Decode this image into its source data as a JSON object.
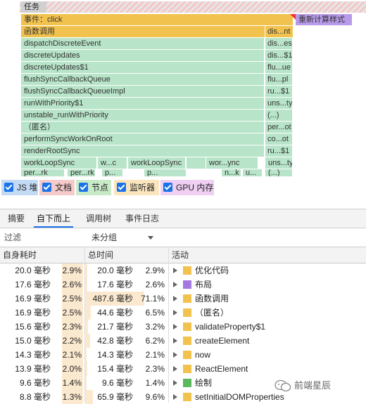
{
  "flame": {
    "task_label": "任务",
    "event_label": "事件：click",
    "recalc_label": "重新计算样式",
    "rows": [
      {
        "name": "函数调用",
        "side": "dis...nt",
        "color": "yellow"
      },
      {
        "name": "dispatchDiscreteEvent",
        "side": "dis...es",
        "color": "green"
      },
      {
        "name": "discreteUpdates",
        "side": "dis...$1",
        "color": "green"
      },
      {
        "name": "discreteUpdates$1",
        "side": "flu...ue",
        "color": "green"
      },
      {
        "name": "flushSyncCallbackQueue",
        "side": "flu...pl",
        "color": "green"
      },
      {
        "name": "flushSyncCallbackQueueImpl",
        "side": "ru...$1",
        "color": "green"
      },
      {
        "name": "runWithPriority$1",
        "side": "uns...ty",
        "color": "green"
      },
      {
        "name": "unstable_runWithPriority",
        "side": "(...)",
        "color": "green"
      },
      {
        "name": "（匿名）",
        "side": "per...ot",
        "color": "green"
      },
      {
        "name": "performSyncWorkOnRoot",
        "side": "co...ot",
        "color": "green"
      },
      {
        "name": "renderRootSync",
        "side": "ru...$1",
        "color": "green"
      }
    ],
    "work_row": [
      "workLoopSync",
      "w...c",
      "workLoopSync",
      "wor...ync",
      "uns...ty"
    ],
    "last_row": [
      "per...rk",
      "per...rk",
      "p...",
      "p...",
      "n...k",
      "u...",
      "(...)"
    ]
  },
  "filters": [
    {
      "label": "JS 堆",
      "color": "#4a90e2"
    },
    {
      "label": "文档",
      "color": "#e06060"
    },
    {
      "label": "节点",
      "color": "#5bc15b"
    },
    {
      "label": "监听器",
      "color": "#f0b23a"
    },
    {
      "label": "GPU 内存",
      "color": "#d070d8"
    }
  ],
  "tabs": [
    "摘要",
    "自下而上",
    "调用树",
    "事件日志"
  ],
  "active_tab": "自下而上",
  "filter_placeholder": "过滤",
  "group_value": "未分组",
  "columns": {
    "self": "自身耗时",
    "total": "总时间",
    "activity": "活动"
  },
  "rows": [
    {
      "self": "20.0 毫秒",
      "self_pct": "2.9%",
      "total": "20.0 毫秒",
      "total_pct": "2.9%",
      "name": "优化代码",
      "color": "#f2c24f",
      "total_share": 0.029
    },
    {
      "self": "17.6 毫秒",
      "self_pct": "2.6%",
      "total": "17.6 毫秒",
      "total_pct": "2.6%",
      "name": "布局",
      "color": "#a57ae0",
      "total_share": 0.026
    },
    {
      "self": "16.9 毫秒",
      "self_pct": "2.5%",
      "total": "487.6 毫秒",
      "total_pct": "71.1%",
      "name": "函数调用",
      "color": "#f2c24f",
      "total_share": 0.711
    },
    {
      "self": "16.9 毫秒",
      "self_pct": "2.5%",
      "total": "44.6 毫秒",
      "total_pct": "6.5%",
      "name": "（匿名）",
      "color": "#f2c24f",
      "total_share": 0.065
    },
    {
      "self": "15.6 毫秒",
      "self_pct": "2.3%",
      "total": "21.7 毫秒",
      "total_pct": "3.2%",
      "name": "validateProperty$1",
      "color": "#f2c24f",
      "total_share": 0.032
    },
    {
      "self": "15.0 毫秒",
      "self_pct": "2.2%",
      "total": "42.8 毫秒",
      "total_pct": "6.2%",
      "name": "createElement",
      "color": "#f2c24f",
      "total_share": 0.062
    },
    {
      "self": "14.3 毫秒",
      "self_pct": "2.1%",
      "total": "14.3 毫秒",
      "total_pct": "2.1%",
      "name": "now",
      "color": "#f2c24f",
      "total_share": 0.021
    },
    {
      "self": "13.9 毫秒",
      "self_pct": "2.0%",
      "total": "15.4 毫秒",
      "total_pct": "2.3%",
      "name": "ReactElement",
      "color": "#f2c24f",
      "total_share": 0.023
    },
    {
      "self": "9.6 毫秒",
      "self_pct": "1.4%",
      "total": "9.6 毫秒",
      "total_pct": "1.4%",
      "name": "绘制",
      "color": "#5cb85c",
      "total_share": 0.014
    },
    {
      "self": "8.8 毫秒",
      "self_pct": "1.3%",
      "total": "65.9 毫秒",
      "total_pct": "9.6%",
      "name": "setInitialDOMProperties",
      "color": "#f2c24f",
      "total_share": 0.096
    }
  ],
  "watermark": "前端星辰"
}
